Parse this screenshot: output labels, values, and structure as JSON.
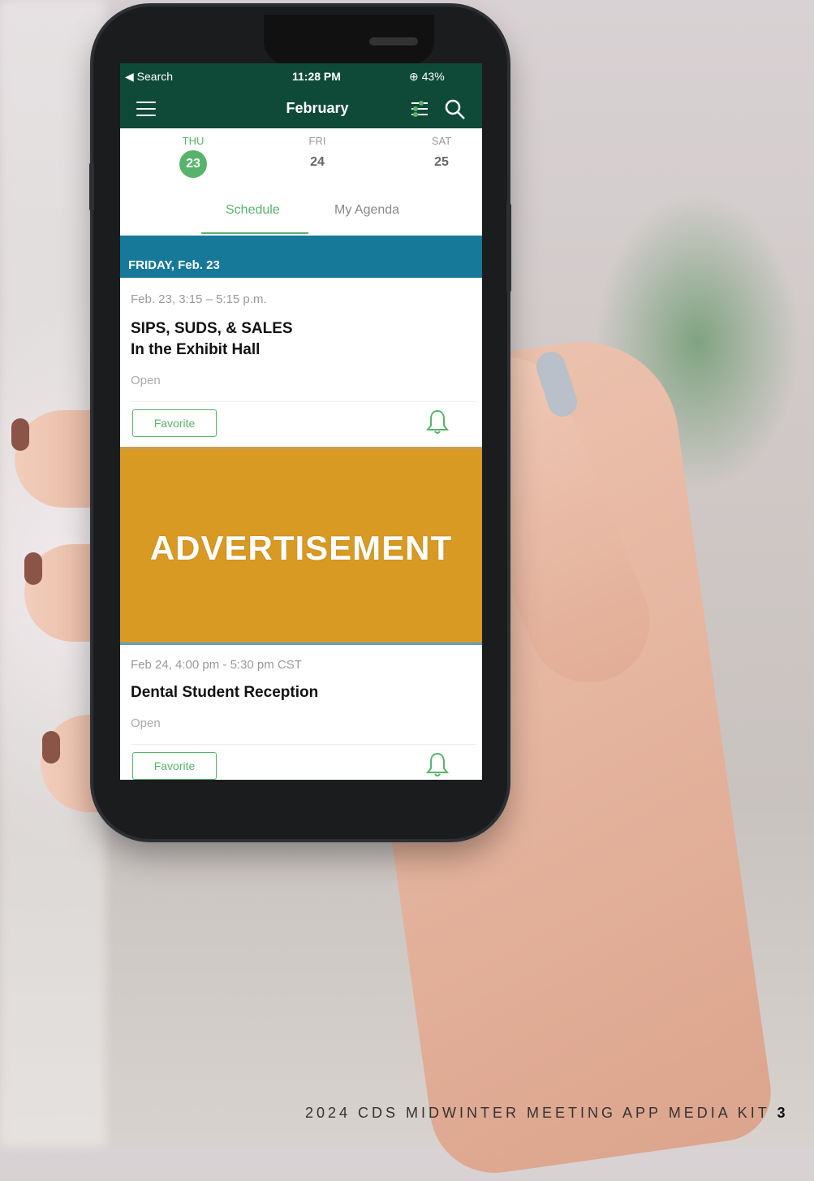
{
  "status_bar": {
    "carrier": "◀ Search",
    "time": "11:28 PM",
    "battery": "⊕ 43%"
  },
  "nav": {
    "title": "February"
  },
  "days": [
    {
      "dow": "THU",
      "num": "23",
      "active": true
    },
    {
      "dow": "FRI",
      "num": "24",
      "active": false
    },
    {
      "dow": "SAT",
      "num": "25",
      "active": false
    }
  ],
  "tabs": {
    "schedule": "Schedule",
    "agenda": "My Agenda"
  },
  "section": {
    "label": "FRIDAY, Feb. 23"
  },
  "events": [
    {
      "time": "Feb. 23, 3:15 – 5:15 p.m.",
      "title_line1": "SIPS, SUDS, & SALES",
      "title_line2": "In the Exhibit Hall",
      "status": "Open",
      "favorite_label": "Favorite"
    },
    {
      "time": "Feb 24, 4:00 pm - 5:30 pm CST",
      "title_line1": "Dental Student Reception",
      "status": "Open",
      "favorite_label": "Favorite"
    }
  ],
  "ad": {
    "label": "ADVERTISEMENT"
  },
  "footer": {
    "text": "2024 CDS MIDWINTER MEETING APP MEDIA KIT",
    "page": "3"
  },
  "colors": {
    "header_green": "#0f4a38",
    "accent_green": "#58b36a",
    "section_blue": "#17799a",
    "ad_gold": "#d99a24"
  }
}
